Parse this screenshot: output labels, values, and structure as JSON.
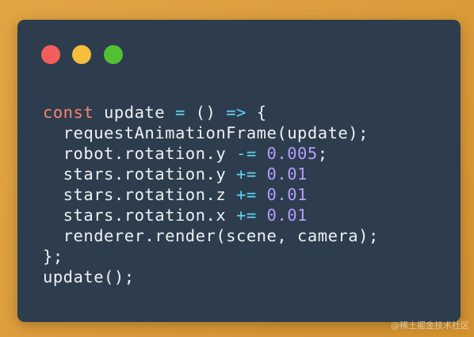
{
  "window": {
    "controls": [
      "close",
      "minimize",
      "maximize"
    ],
    "colors": {
      "background": "#2d3d4d",
      "close": "#f45d5d",
      "minimize": "#f5be3c",
      "maximize": "#52c131"
    }
  },
  "code": {
    "syntax_colors": {
      "keyword": "#ff8070",
      "operator": "#5fd4f5",
      "number": "#b49cff",
      "text": "#eef1f4"
    },
    "lines": [
      [
        {
          "t": "const",
          "k": "kw"
        },
        {
          "t": " update ",
          "k": "txt"
        },
        {
          "t": "=",
          "k": "op"
        },
        {
          "t": " () ",
          "k": "txt"
        },
        {
          "t": "=>",
          "k": "op"
        },
        {
          "t": " {",
          "k": "txt"
        }
      ],
      [
        {
          "t": "  requestAnimationFrame(update);",
          "k": "txt"
        }
      ],
      [
        {
          "t": "  robot.rotation.y ",
          "k": "txt"
        },
        {
          "t": "-=",
          "k": "op"
        },
        {
          "t": " ",
          "k": "txt"
        },
        {
          "t": "0.005",
          "k": "num"
        },
        {
          "t": ";",
          "k": "txt"
        }
      ],
      [
        {
          "t": "  stars.rotation.y ",
          "k": "txt"
        },
        {
          "t": "+=",
          "k": "op"
        },
        {
          "t": " ",
          "k": "txt"
        },
        {
          "t": "0.01",
          "k": "num"
        }
      ],
      [
        {
          "t": "  stars.rotation.z ",
          "k": "txt"
        },
        {
          "t": "+=",
          "k": "op"
        },
        {
          "t": " ",
          "k": "txt"
        },
        {
          "t": "0.01",
          "k": "num"
        }
      ],
      [
        {
          "t": "  stars.rotation.x ",
          "k": "txt"
        },
        {
          "t": "+=",
          "k": "op"
        },
        {
          "t": " ",
          "k": "txt"
        },
        {
          "t": "0.01",
          "k": "num"
        }
      ],
      [
        {
          "t": "  renderer.render(scene, camera);",
          "k": "txt"
        }
      ],
      [
        {
          "t": "};",
          "k": "txt"
        }
      ],
      [
        {
          "t": "update();",
          "k": "txt"
        }
      ]
    ]
  },
  "watermark": {
    "text": "@稀土掘金技术社区"
  }
}
